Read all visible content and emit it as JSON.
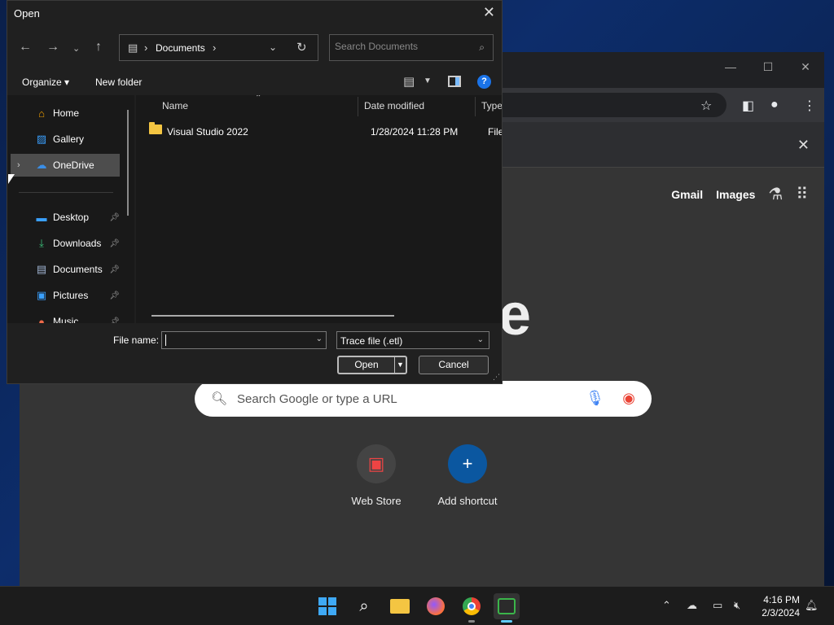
{
  "dialog": {
    "title": "Open",
    "address": {
      "crumb": "Documents"
    },
    "search_placeholder": "Search Documents",
    "cmd": {
      "organize": "Organize",
      "new_folder": "New folder",
      "help": "?"
    },
    "nav": [
      {
        "label": "Home",
        "icon": "home-icon",
        "pinned": false
      },
      {
        "label": "Gallery",
        "icon": "gallery-icon",
        "pinned": false
      },
      {
        "label": "OneDrive",
        "icon": "onedrive-icon",
        "pinned": false,
        "selected": true
      },
      {
        "label": "Desktop",
        "icon": "desktop-icon",
        "pinned": true
      },
      {
        "label": "Downloads",
        "icon": "download-icon",
        "pinned": true
      },
      {
        "label": "Documents",
        "icon": "documents-icon",
        "pinned": true
      },
      {
        "label": "Pictures",
        "icon": "pictures-icon",
        "pinned": true
      },
      {
        "label": "Music",
        "icon": "music-icon",
        "pinned": true
      }
    ],
    "columns": {
      "name": "Name",
      "date": "Date modified",
      "type": "Type"
    },
    "files": [
      {
        "name": "Visual Studio 2022",
        "date": "1/28/2024 11:28 PM",
        "type": "File fo"
      }
    ],
    "file_name_label": "File name:",
    "file_name_value": "",
    "filter_value": "Trace file (.etl)",
    "open_button": "Open",
    "cancel_button": "Cancel"
  },
  "chrome": {
    "links": {
      "gmail": "Gmail",
      "images": "Images"
    },
    "search_placeholder": "Search Google or type a URL",
    "shortcuts": [
      {
        "label": "Web Store"
      },
      {
        "label": "Add shortcut"
      }
    ]
  },
  "taskbar": {
    "time": "4:16 PM",
    "date": "2/3/2024"
  }
}
